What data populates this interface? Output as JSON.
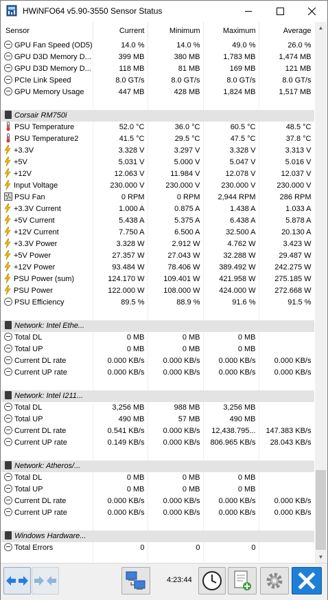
{
  "window": {
    "title": "HWiNFO64 v5.90-3550 Sensor Status"
  },
  "columns": [
    "Sensor",
    "Current",
    "Minimum",
    "Maximum",
    "Average"
  ],
  "rows": [
    {
      "kind": "sensor",
      "icon": "gauge",
      "name": "GPU Fan Speed (OD5)",
      "current": "14.0 %",
      "minimum": "14.0 %",
      "maximum": "49.0 %",
      "average": "26.0 %"
    },
    {
      "kind": "sensor",
      "icon": "gauge",
      "name": "GPU D3D Memory D...",
      "current": "399 MB",
      "minimum": "380 MB",
      "maximum": "1,783 MB",
      "average": "1,474 MB"
    },
    {
      "kind": "sensor",
      "icon": "gauge",
      "name": "GPU D3D Memory D...",
      "current": "118 MB",
      "minimum": "81 MB",
      "maximum": "169 MB",
      "average": "121 MB"
    },
    {
      "kind": "sensor",
      "icon": "gauge",
      "name": "PCIe Link Speed",
      "current": "8.0 GT/s",
      "minimum": "8.0 GT/s",
      "maximum": "8.0 GT/s",
      "average": "8.0 GT/s"
    },
    {
      "kind": "sensor",
      "icon": "gauge",
      "name": "GPU Memory Usage",
      "current": "447 MB",
      "minimum": "428 MB",
      "maximum": "1,824 MB",
      "average": "1,517 MB"
    },
    {
      "kind": "gap"
    },
    {
      "kind": "group",
      "name": "Corsair RM750i"
    },
    {
      "kind": "sensor",
      "icon": "therm",
      "name": "PSU Temperature",
      "current": "52.0 °C",
      "minimum": "36.0 °C",
      "maximum": "60.5 °C",
      "average": "48.5 °C"
    },
    {
      "kind": "sensor",
      "icon": "therm",
      "name": "PSU Temperature2",
      "current": "41.5 °C",
      "minimum": "29.5 °C",
      "maximum": "47.5 °C",
      "average": "37.8 °C"
    },
    {
      "kind": "sensor",
      "icon": "bolt",
      "name": "+3.3V",
      "current": "3.328 V",
      "minimum": "3.297 V",
      "maximum": "3.328 V",
      "average": "3.313 V"
    },
    {
      "kind": "sensor",
      "icon": "bolt",
      "name": "+5V",
      "current": "5.031 V",
      "minimum": "5.000 V",
      "maximum": "5.047 V",
      "average": "5.016 V"
    },
    {
      "kind": "sensor",
      "icon": "bolt",
      "name": "+12V",
      "current": "12.063 V",
      "minimum": "11.984 V",
      "maximum": "12.078 V",
      "average": "12.037 V"
    },
    {
      "kind": "sensor",
      "icon": "bolt",
      "name": "Input Voltage",
      "current": "230.000 V",
      "minimum": "230.000 V",
      "maximum": "230.000 V",
      "average": "230.000 V"
    },
    {
      "kind": "sensor",
      "icon": "fan",
      "name": "PSU Fan",
      "current": "0 RPM",
      "minimum": "0 RPM",
      "maximum": "2,944 RPM",
      "average": "286 RPM"
    },
    {
      "kind": "sensor",
      "icon": "bolt",
      "name": "+3.3V Current",
      "current": "1.000 A",
      "minimum": "0.875 A",
      "maximum": "1.438 A",
      "average": "1.033 A"
    },
    {
      "kind": "sensor",
      "icon": "bolt",
      "name": "+5V Current",
      "current": "5.438 A",
      "minimum": "5.375 A",
      "maximum": "6.438 A",
      "average": "5.878 A"
    },
    {
      "kind": "sensor",
      "icon": "bolt",
      "name": "+12V Current",
      "current": "7.750 A",
      "minimum": "6.500 A",
      "maximum": "32.500 A",
      "average": "20.130 A"
    },
    {
      "kind": "sensor",
      "icon": "bolt",
      "name": "+3.3V Power",
      "current": "3.328 W",
      "minimum": "2.912 W",
      "maximum": "4.762 W",
      "average": "3.423 W"
    },
    {
      "kind": "sensor",
      "icon": "bolt",
      "name": "+5V Power",
      "current": "27.357 W",
      "minimum": "27.043 W",
      "maximum": "32.288 W",
      "average": "29.487 W"
    },
    {
      "kind": "sensor",
      "icon": "bolt",
      "name": "+12V Power",
      "current": "93.484 W",
      "minimum": "78.406 W",
      "maximum": "389.492 W",
      "average": "242.275 W"
    },
    {
      "kind": "sensor",
      "icon": "bolt",
      "name": "PSU Power (sum)",
      "current": "124.170 W",
      "minimum": "109.401 W",
      "maximum": "421.958 W",
      "average": "275.185 W"
    },
    {
      "kind": "sensor",
      "icon": "bolt",
      "name": "PSU Power",
      "current": "122.000 W",
      "minimum": "108.000 W",
      "maximum": "424.000 W",
      "average": "272.668 W"
    },
    {
      "kind": "sensor",
      "icon": "gauge",
      "name": "PSU Efficiency",
      "current": "89.5 %",
      "minimum": "88.9 %",
      "maximum": "91.6 %",
      "average": "91.5 %"
    },
    {
      "kind": "gap"
    },
    {
      "kind": "group",
      "name": "Network: Intel Ethe..."
    },
    {
      "kind": "sensor",
      "icon": "gauge",
      "name": "Total DL",
      "current": "0 MB",
      "minimum": "0 MB",
      "maximum": "0 MB",
      "average": ""
    },
    {
      "kind": "sensor",
      "icon": "gauge",
      "name": "Total UP",
      "current": "0 MB",
      "minimum": "0 MB",
      "maximum": "0 MB",
      "average": ""
    },
    {
      "kind": "sensor",
      "icon": "gauge",
      "name": "Current DL rate",
      "current": "0.000 KB/s",
      "minimum": "0.000 KB/s",
      "maximum": "0.000 KB/s",
      "average": "0.000 KB/s"
    },
    {
      "kind": "sensor",
      "icon": "gauge",
      "name": "Current UP rate",
      "current": "0.000 KB/s",
      "minimum": "0.000 KB/s",
      "maximum": "0.000 KB/s",
      "average": "0.000 KB/s"
    },
    {
      "kind": "gap"
    },
    {
      "kind": "group",
      "name": "Network: Intel I211..."
    },
    {
      "kind": "sensor",
      "icon": "gauge",
      "name": "Total DL",
      "current": "3,256 MB",
      "minimum": "988 MB",
      "maximum": "3,256 MB",
      "average": ""
    },
    {
      "kind": "sensor",
      "icon": "gauge",
      "name": "Total UP",
      "current": "490 MB",
      "minimum": "57 MB",
      "maximum": "490 MB",
      "average": ""
    },
    {
      "kind": "sensor",
      "icon": "gauge",
      "name": "Current DL rate",
      "current": "0.541 KB/s",
      "minimum": "0.000 KB/s",
      "maximum": "12,438.795...",
      "average": "147.383 KB/s"
    },
    {
      "kind": "sensor",
      "icon": "gauge",
      "name": "Current UP rate",
      "current": "0.149 KB/s",
      "minimum": "0.000 KB/s",
      "maximum": "806.965 KB/s",
      "average": "28.043 KB/s"
    },
    {
      "kind": "gap"
    },
    {
      "kind": "group",
      "name": "Network: Atheros/..."
    },
    {
      "kind": "sensor",
      "icon": "gauge",
      "name": "Total DL",
      "current": "0 MB",
      "minimum": "0 MB",
      "maximum": "0 MB",
      "average": ""
    },
    {
      "kind": "sensor",
      "icon": "gauge",
      "name": "Total UP",
      "current": "0 MB",
      "minimum": "0 MB",
      "maximum": "0 MB",
      "average": ""
    },
    {
      "kind": "sensor",
      "icon": "gauge",
      "name": "Current DL rate",
      "current": "0.000 KB/s",
      "minimum": "0.000 KB/s",
      "maximum": "0.000 KB/s",
      "average": "0.000 KB/s"
    },
    {
      "kind": "sensor",
      "icon": "gauge",
      "name": "Current UP rate",
      "current": "0.000 KB/s",
      "minimum": "0.000 KB/s",
      "maximum": "0.000 KB/s",
      "average": "0.000 KB/s"
    },
    {
      "kind": "gap"
    },
    {
      "kind": "group",
      "name": "Windows Hardware..."
    },
    {
      "kind": "sensor",
      "icon": "gauge",
      "name": "Total Errors",
      "current": "0",
      "minimum": "0",
      "maximum": "0",
      "average": ""
    },
    {
      "kind": "gap"
    }
  ],
  "toolbar": {
    "elapsed_time": "4:23:44",
    "buttons": [
      "expand-arrows-icon",
      "collapse-arrows-icon",
      "network-icon",
      "clock-icon",
      "add-report-icon",
      "settings-gear-icon",
      "close-x-icon"
    ]
  },
  "colors": {
    "group_bg": "#e3e3e3",
    "bolt": "#e8b400",
    "close_btn": "#1e7fd6"
  }
}
